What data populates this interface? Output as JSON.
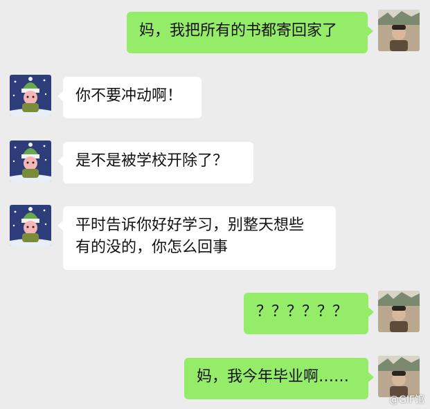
{
  "messages": [
    {
      "side": "sent",
      "lines": [
        "妈，我把所有的书都寄回家了"
      ]
    },
    {
      "side": "recv",
      "lines": [
        "你不要冲动啊！"
      ]
    },
    {
      "side": "recv",
      "lines": [
        "是不是被学校开除了？"
      ]
    },
    {
      "side": "recv",
      "lines": [
        "平时告诉你好好学习，别整天想些",
        "有的没的，你怎么回事"
      ]
    },
    {
      "side": "sent",
      "lines": [
        "？？？？？？"
      ]
    },
    {
      "side": "sent",
      "lines": [
        "妈，我今年毕业啊……"
      ]
    }
  ],
  "watermark": "@GIF馆",
  "colors": {
    "background": "#ececec",
    "sent_bubble": "#95ec69",
    "recv_bubble": "#ffffff"
  },
  "avatars": {
    "mother": "snowy-night-knit-hat-character-avatar",
    "son": "photo-avatar"
  }
}
